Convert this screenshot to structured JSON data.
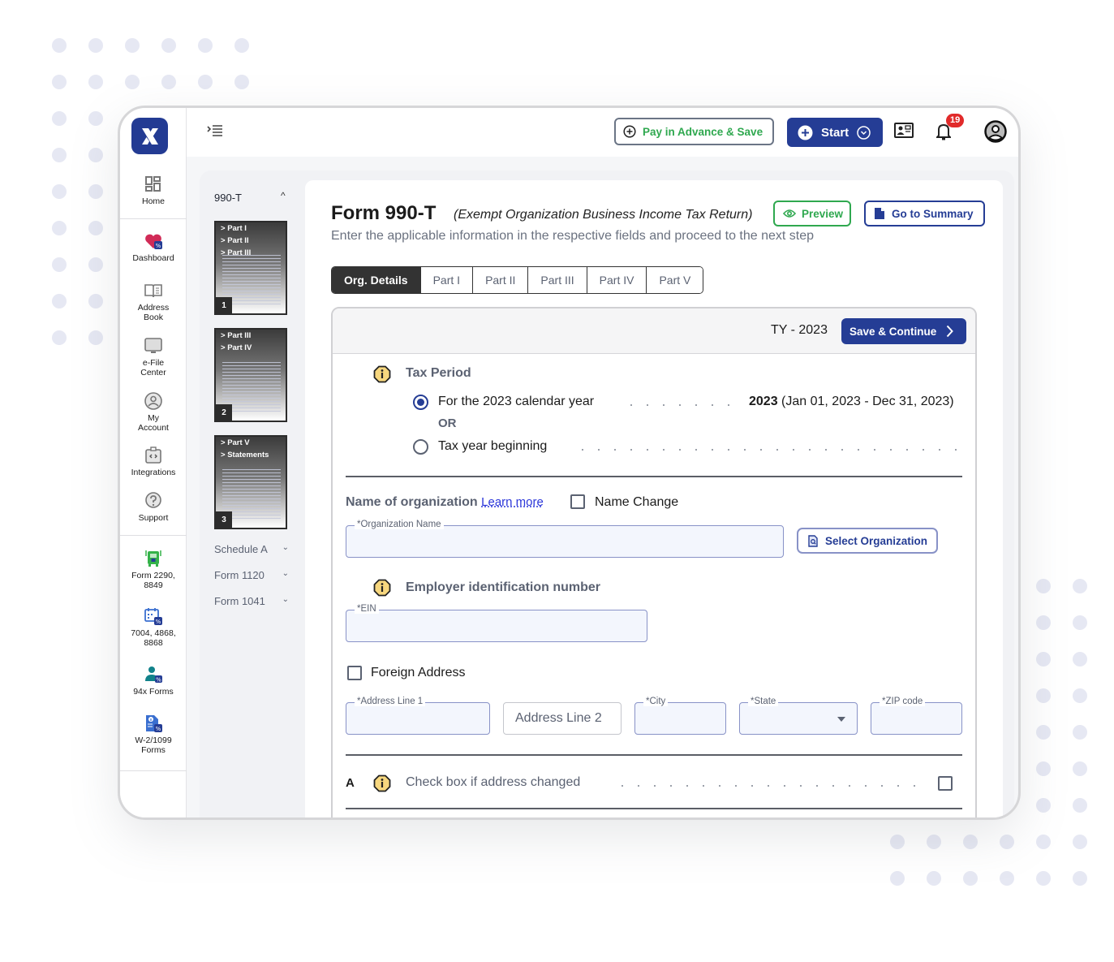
{
  "app": {
    "brand_color": "#253d95",
    "accent_green": "#2fa84f"
  },
  "sidebar": {
    "items": [
      {
        "label": "Home",
        "icon": "home-grid-icon"
      },
      {
        "label": "Dashboard",
        "icon": "heart-dashboard-icon"
      },
      {
        "label": "Address Book",
        "icon": "address-book-icon"
      },
      {
        "label": "e-File Center",
        "icon": "monitor-icon"
      },
      {
        "label": "My Account",
        "icon": "user-circle-icon"
      },
      {
        "label": "Integrations",
        "icon": "integrations-icon"
      },
      {
        "label": "Support",
        "icon": "help-icon"
      },
      {
        "label": "Form 2290, 8849",
        "icon": "truck-icon"
      },
      {
        "label": "7004, 4868, 8868",
        "icon": "calendar-icon"
      },
      {
        "label": "94x Forms",
        "icon": "employee-icon"
      },
      {
        "label": "W-2/1099 Forms",
        "icon": "document-info-icon"
      }
    ]
  },
  "topbar": {
    "pay_label": "Pay in Advance & Save",
    "start_label": "Start",
    "notification_count": "19"
  },
  "forms_nav": {
    "current_form": "990-T",
    "pages": [
      {
        "number": "1",
        "parts": [
          "Part I",
          "Part II",
          "Part III"
        ]
      },
      {
        "number": "2",
        "parts": [
          "Part III",
          "Part IV"
        ]
      },
      {
        "number": "3",
        "parts": [
          "Part V",
          "Statements"
        ]
      }
    ],
    "accordions": [
      "Schedule A",
      "Form 1120",
      "Form 1041"
    ]
  },
  "main": {
    "title": "Form 990-T",
    "subtitle": "(Exempt Organization Business Income Tax Return)",
    "preview_label": "Preview",
    "summary_label": "Go to Summary",
    "instructions": "Enter the applicable information in the respective fields and proceed to the next step",
    "tabs": [
      {
        "label": "Org. Details",
        "active": true
      },
      {
        "label": "Part I",
        "active": false
      },
      {
        "label": "Part II",
        "active": false
      },
      {
        "label": "Part III",
        "active": false
      },
      {
        "label": "Part IV",
        "active": false
      },
      {
        "label": "Part V",
        "active": false
      }
    ]
  },
  "form": {
    "tax_year_label": "TY - 2023",
    "save_continue_label": "Save & Continue",
    "tax_period": {
      "title": "Tax Period",
      "option_calendar": "For the 2023 calendar year",
      "calendar_year_bold": "2023",
      "calendar_year_range": "(Jan 01, 2023 - Dec 31, 2023)",
      "or_label": "OR",
      "option_beginning": "Tax year beginning",
      "selected": "calendar"
    },
    "org_name": {
      "title": "Name of organization",
      "learn_more": "Learn more",
      "name_change_label": "Name Change",
      "name_change_checked": false,
      "field_label": "*Organization Name",
      "value": "",
      "select_org_label": "Select Organization"
    },
    "ein": {
      "title": "Employer identification number",
      "field_label": "*EIN",
      "value": ""
    },
    "address": {
      "foreign_label": "Foreign Address",
      "foreign_checked": false,
      "line1_label": "*Address Line 1",
      "line2_placeholder": "Address Line 2",
      "city_label": "*City",
      "state_label": "*State",
      "zip_label": "*ZIP code"
    },
    "line_a": {
      "letter": "A",
      "label": "Check box if address changed",
      "checked": false
    }
  }
}
